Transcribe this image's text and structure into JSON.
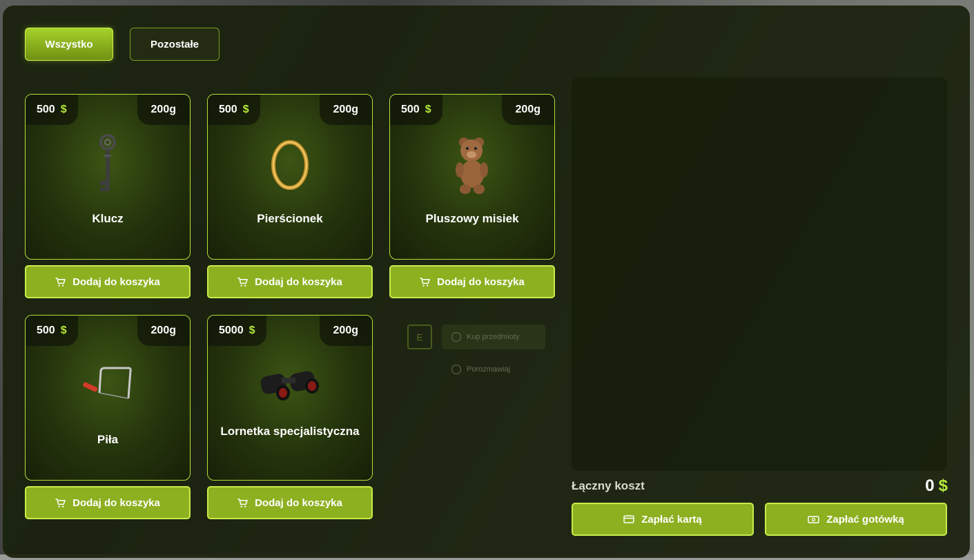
{
  "tabs": [
    {
      "label": "Wszystko",
      "active": true
    },
    {
      "label": "Pozostałe",
      "active": false
    }
  ],
  "add_to_cart_label": "Dodaj do koszyka",
  "currency_symbol": "$",
  "items": [
    {
      "name": "Klucz",
      "price": "500",
      "weight": "200g",
      "icon": "key-icon"
    },
    {
      "name": "Pierścionek",
      "price": "500",
      "weight": "200g",
      "icon": "ring-icon"
    },
    {
      "name": "Pluszowy misiek",
      "price": "500",
      "weight": "200g",
      "icon": "teddy-bear-icon"
    },
    {
      "name": "Piła",
      "price": "500",
      "weight": "200g",
      "icon": "saw-icon"
    },
    {
      "name": "Lornetka specjalistyczna",
      "price": "5000",
      "weight": "200g",
      "icon": "binoculars-icon"
    }
  ],
  "background_prompt": {
    "key": "E",
    "buy_label": "Kup przedmioty",
    "talk_label": "Porozmawiaj"
  },
  "cart": {
    "total_label": "Łączny koszt",
    "total_value": "0",
    "pay_card_label": "Zapłać kartą",
    "pay_cash_label": "Zapłać gotówką"
  },
  "colors": {
    "accent": "#8cb020",
    "accent_border": "#c9ec4a",
    "currency": "#b6e83a",
    "panel": "#19210d"
  }
}
